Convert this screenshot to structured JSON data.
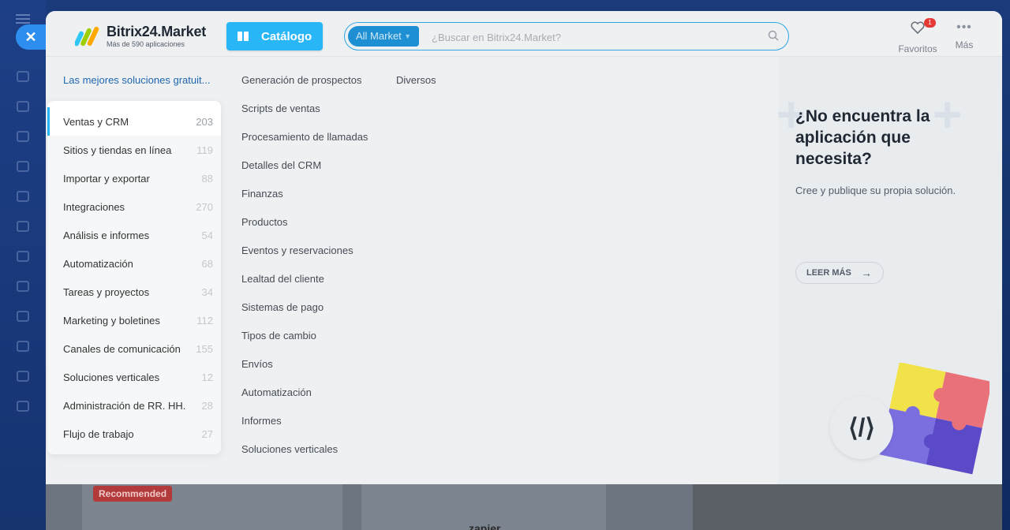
{
  "app": {
    "name": "Bitrix24.Market",
    "subtitle": "Más de 590 aplicaciones"
  },
  "toolbar": {
    "catalog_label": "Catálogo",
    "search_scope": "All Market",
    "search_placeholder": "¿Buscar en Bitrix24.Market?",
    "favorites_label": "Favoritos",
    "favorites_count": "1",
    "more_label": "Más"
  },
  "left": {
    "top_link": "Las mejores soluciones gratuit..."
  },
  "categories": [
    {
      "label": "Ventas y CRM",
      "count": "203"
    },
    {
      "label": "Sitios y tiendas en línea",
      "count": "119"
    },
    {
      "label": "Importar y exportar",
      "count": "88"
    },
    {
      "label": "Integraciones",
      "count": "270"
    },
    {
      "label": "Análisis e informes",
      "count": "54"
    },
    {
      "label": "Automatización",
      "count": "68"
    },
    {
      "label": "Tareas y proyectos",
      "count": "34"
    },
    {
      "label": "Marketing y boletines",
      "count": "112"
    },
    {
      "label": "Canales de comunicación",
      "count": "155"
    },
    {
      "label": "Soluciones verticales",
      "count": "12"
    },
    {
      "label": "Administración de RR. HH.",
      "count": "28"
    },
    {
      "label": "Flujo de trabajo",
      "count": "27"
    }
  ],
  "subcategories": {
    "col1": [
      "Generación de prospectos",
      "Scripts de ventas",
      "Procesamiento de llamadas",
      "Detalles del CRM",
      "Finanzas",
      "Productos",
      "Eventos y reservaciones",
      "Lealtad del cliente",
      "Sistemas de pago",
      "Tipos de cambio",
      "Envíos",
      "Automatización",
      "Informes",
      "Soluciones verticales"
    ],
    "col2": [
      "Diversos"
    ]
  },
  "promo": {
    "title": "¿No encuentra la aplicación que necesita?",
    "description": "Cree y publique su propia solución.",
    "button_label": "LEER MÁS",
    "code_glyph": "⟨/⟩"
  },
  "background": {
    "recommended_badge": "Recommended",
    "zapier_label": "zapier"
  },
  "colors": {
    "accent": "#29b6f6",
    "link": "#2067b0",
    "badge": "#e53935"
  }
}
